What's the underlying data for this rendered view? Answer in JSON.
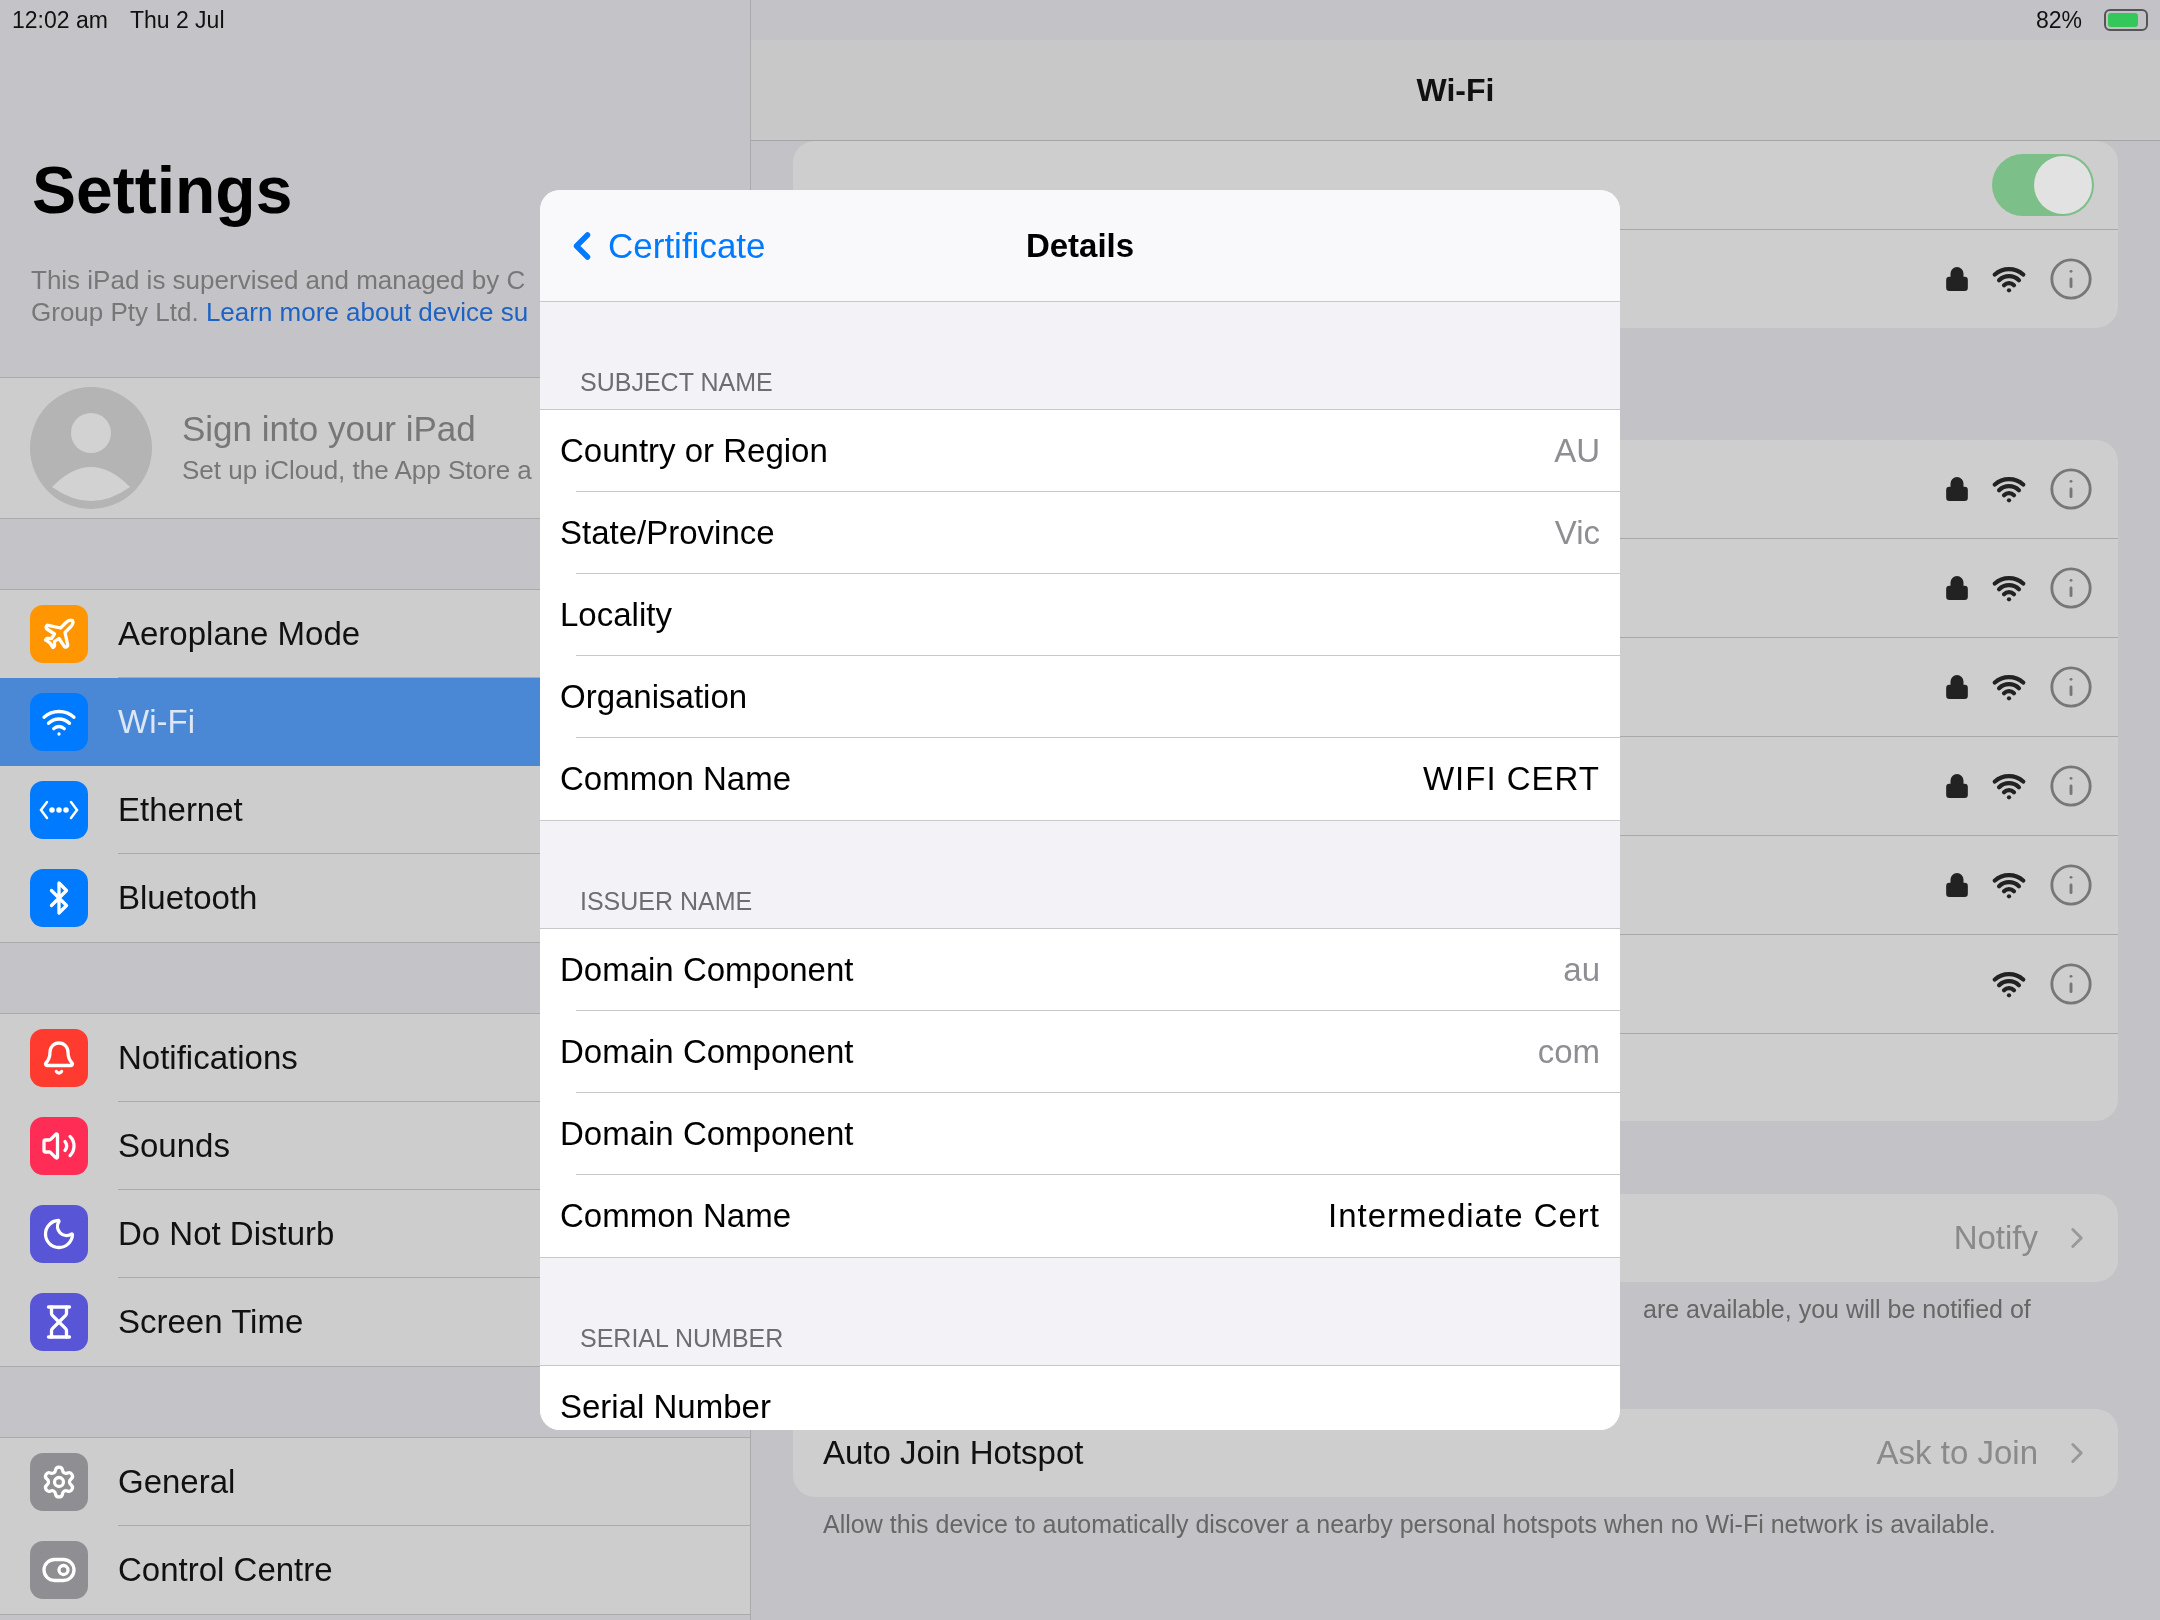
{
  "status_bar": {
    "time": "12:02 am",
    "date": "Thu 2 Jul",
    "battery": "82%",
    "charging": true
  },
  "sidebar": {
    "title": "Settings",
    "supervision_text": "This iPad is supervised and managed by C",
    "supervision_text_2": "Group Pty Ltd.",
    "supervision_link": "Learn more about device su",
    "account": {
      "title": "Sign into your iPad",
      "subtitle": "Set up iCloud, the App Store a"
    },
    "groups": [
      [
        {
          "label": "Aeroplane Mode",
          "color": "#ff9500",
          "selected": false
        },
        {
          "label": "Wi-Fi",
          "color": "#007aff",
          "selected": true
        },
        {
          "label": "Ethernet",
          "color": "#007aff",
          "selected": false
        },
        {
          "label": "Bluetooth",
          "color": "#007aff",
          "selected": false
        }
      ],
      [
        {
          "label": "Notifications",
          "color": "#ff3b30",
          "selected": false
        },
        {
          "label": "Sounds",
          "color": "#ff2d55",
          "selected": false
        },
        {
          "label": "Do Not Disturb",
          "color": "#5856d6",
          "selected": false
        },
        {
          "label": "Screen Time",
          "color": "#5856d6",
          "selected": false
        }
      ],
      [
        {
          "label": "General",
          "color": "#8e8e93",
          "selected": false
        },
        {
          "label": "Control Centre",
          "color": "#8e8e93",
          "selected": false
        }
      ]
    ]
  },
  "main": {
    "title": "Wi-Fi",
    "wifi_on": true,
    "current_network": {
      "secured": true
    },
    "networks": [
      {
        "secured": true
      },
      {
        "secured": true
      },
      {
        "secured": true
      },
      {
        "secured": true
      },
      {
        "secured": true
      },
      {
        "secured": false
      }
    ],
    "ask_row": {
      "value": "Notify"
    },
    "ask_footer": "are available, you will be notified of",
    "hotspot_row": {
      "label": "Auto Join Hotspot",
      "value": "Ask to Join"
    },
    "hotspot_footer": "Allow this device to automatically discover a nearby personal hotspots when no Wi-Fi network is available."
  },
  "modal": {
    "back": "Certificate",
    "title": "Details",
    "sections": [
      {
        "header": "SUBJECT NAME",
        "rows": [
          {
            "label": "Country or Region",
            "value": "AU"
          },
          {
            "label": "State/Province",
            "value": "Vic"
          },
          {
            "label": "Locality"
          },
          {
            "label": "Organisation"
          },
          {
            "label": "Common Name",
            "value": "WIFI CERT",
            "emphasis": true
          }
        ]
      },
      {
        "header": "ISSUER NAME",
        "rows": [
          {
            "label": "Domain Component",
            "value": "au"
          },
          {
            "label": "Domain Component",
            "value": "com"
          },
          {
            "label": "Domain Component"
          },
          {
            "label": "Common Name",
            "value": "Intermediate Cert",
            "emphasis": true
          }
        ]
      },
      {
        "header": "SERIAL NUMBER",
        "rows": [
          {
            "label": "Serial Number"
          }
        ]
      }
    ]
  }
}
